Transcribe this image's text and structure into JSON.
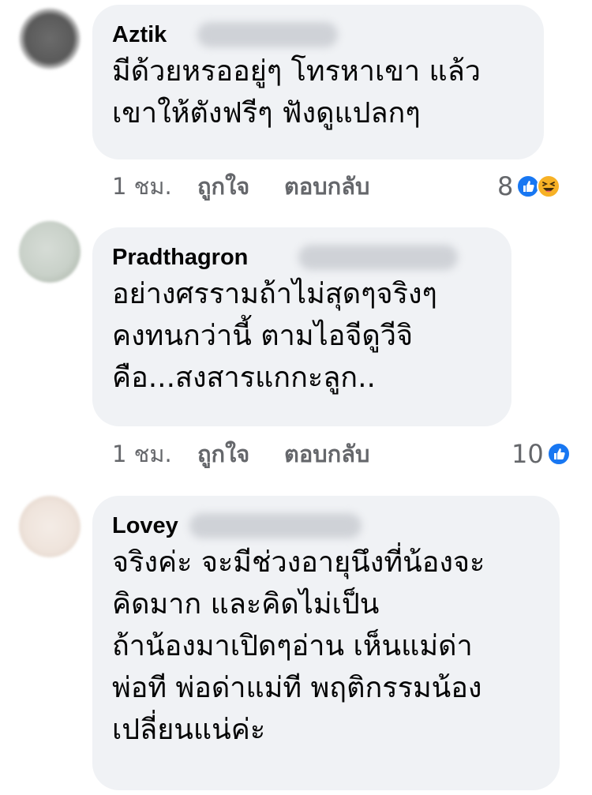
{
  "comments": [
    {
      "author": "Aztik",
      "lines": [
        "มีด้วยหรออยู่ๆ โทรหาเขา แล้ว",
        "เขาให้ตังฟรีๆ ฟังดูแปลกๆ"
      ],
      "time": "1 ชม.",
      "like_label": "ถูกใจ",
      "reply_label": "ตอบกลับ",
      "reaction_count": "8",
      "reactions": [
        "like-icon",
        "haha-icon"
      ]
    },
    {
      "author": "Pradthagron",
      "lines": [
        "อย่างศรรามถ้าไม่สุดๆจริงๆ",
        "คงทนกว่านี้ ตามไอจีดูวีจิ",
        "คือ...สงสารแกกะลูก.."
      ],
      "time": "1 ชม.",
      "like_label": "ถูกใจ",
      "reply_label": "ตอบกลับ",
      "reaction_count": "10",
      "reactions": [
        "like-icon"
      ]
    },
    {
      "author": "Lovey",
      "lines": [
        "จริงค่ะ จะมีช่วงอายุนึงที่น้องจะ",
        "คิดมาก และคิดไม่เป็น",
        "ถ้าน้องมาเปิดๆอ่าน เห็นแม่ด่า",
        "พ่อที พ่อด่าแม่ที พฤติกรรมน้อง",
        "เปลี่ยนแน่ค่ะ"
      ]
    }
  ],
  "colors": {
    "bubble": "#f0f2f5",
    "like_blue": "#1877f2",
    "haha_yellow": "#f7b125",
    "meta_text": "#65676b"
  }
}
